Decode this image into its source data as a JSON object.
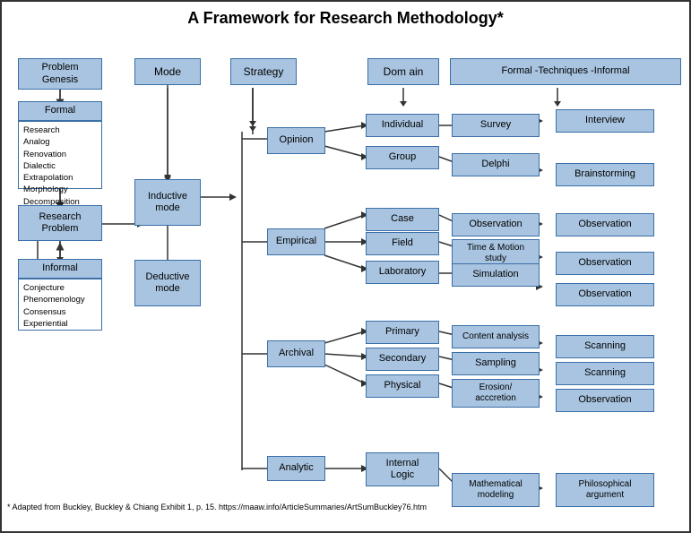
{
  "title": "A Framework for Research Methodology*",
  "footer": "* Adapted from Buckley, Buckley & Chiang Exhibit 1, p. 15.  https://maaw.info/ArticleSummaries/ArtSumBuckley76.htm",
  "boxes": {
    "problem_genesis": "Problem\nGenesis",
    "formal_label": "Formal",
    "formal_list": "Research\nAnalog\nRenovation\nDialectic\nExtrapolation\nMorphology\nDecomposition\nAggregation",
    "research_problem": "Research\nProblem",
    "informal_label": "Informal",
    "informal_list": "Conjecture\nPhenomenology\nConsensus\nExperiential",
    "mode": "Mode",
    "inductive": "Inductive\nmode",
    "deductive": "Deductive\nmode",
    "strategy": "Strategy",
    "opinion": "Opinion",
    "empirical": "Empirical",
    "archival": "Archival",
    "analytic": "Analytic",
    "domain": "Dom ain",
    "individual": "Individual",
    "group": "Group",
    "case": "Case",
    "field": "Field",
    "laboratory": "Laboratory",
    "primary": "Primary",
    "secondary": "Secondary",
    "physical": "Physical",
    "internal_logic": "Internal\nLogic",
    "formal_techniques_informal": "Formal -Techniques -Informal",
    "survey": "Survey",
    "delphi": "Delphi",
    "observation_case": "Observation",
    "time_motion": "Time & Motion\nstudy",
    "simulation": "Simulation",
    "content_analysis": "Content analysis",
    "sampling": "Sampling",
    "erosion": "Erosion/\nacccretion",
    "mathematical": "Mathematical\nmodeling",
    "interview": "Interview",
    "brainstorming": "Brainstorming",
    "observation_f1": "Observation",
    "observation_f2": "Observation",
    "observation_f3": "Observation",
    "scanning1": "Scanning",
    "scanning2": "Scanning",
    "observation_archival": "Observation",
    "philosophical": "Philosophical\nargument"
  }
}
